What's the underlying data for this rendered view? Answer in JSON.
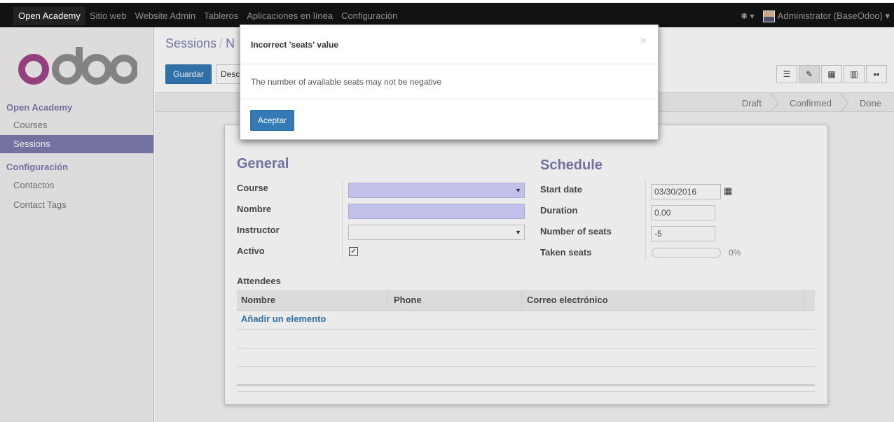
{
  "topbar": {
    "menu": [
      "Open Academy",
      "Sitio web",
      "Website Admin",
      "Tableros",
      "Aplicaciones en línea",
      "Configuración"
    ],
    "user": "Administrator (BaseOdoo)",
    "bug_icon": "bug-icon"
  },
  "sidebar": {
    "logo_text": "odoo",
    "section1": "Open Academy",
    "items1": [
      "Courses",
      "Sessions"
    ],
    "section2": "Configuración",
    "items2": [
      "Contactos",
      "Contact Tags"
    ],
    "active_item": "Sessions"
  },
  "header": {
    "breadcrumb_root": "Sessions",
    "breadcrumb_separator": "/",
    "breadcrumb_current": "N",
    "save_label": "Guardar",
    "discard_label": "Desc"
  },
  "views": [
    "list-icon",
    "form-icon",
    "calendar-icon",
    "graph-icon",
    "kanban-icon"
  ],
  "status": {
    "stages": [
      "Draft",
      "Confirmed",
      "Done"
    ]
  },
  "form": {
    "general_title": "General",
    "schedule_title": "Schedule",
    "course_label": "Course",
    "name_label": "Nombre",
    "instructor_label": "Instructor",
    "active_label": "Activo",
    "active_checked": "✓",
    "start_date_label": "Start date",
    "start_date_value": "03/30/2016",
    "duration_label": "Duration",
    "duration_value": "0.00",
    "seats_label": "Number of seats",
    "seats_value": "-5",
    "taken_label": "Taken seats",
    "taken_value": "0%",
    "taken_fraction": 0
  },
  "attendees": {
    "title": "Attendees",
    "columns": [
      "Nombre",
      "Phone",
      "Correo electrónico"
    ],
    "add_line": "Añadir un elemento"
  },
  "modal": {
    "title": "Incorrect 'seats' value",
    "close": "×",
    "body": "The number of available seats may not be negative",
    "ok_label": "Aceptar"
  },
  "colors": {
    "brand": "#7c7bad",
    "primary": "#337ab7",
    "topbar": "#121212"
  }
}
